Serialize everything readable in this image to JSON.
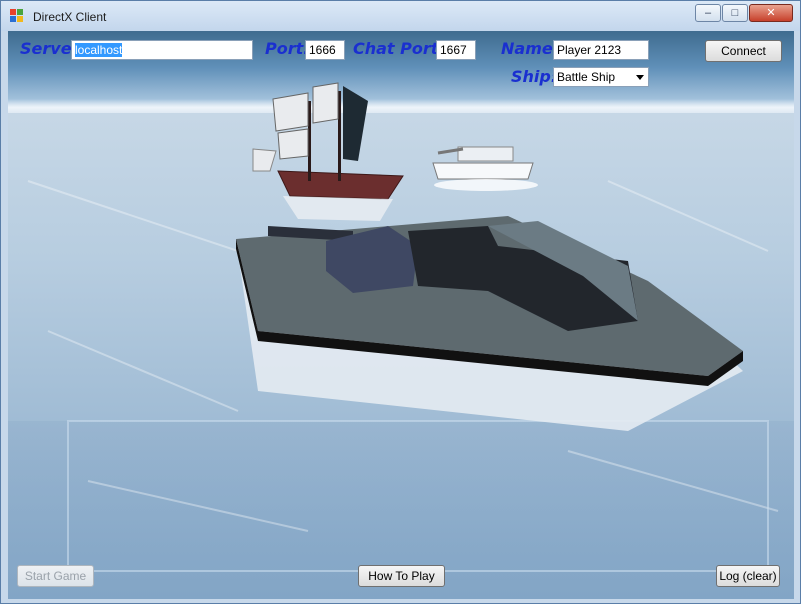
{
  "window": {
    "title": "DirectX Client",
    "minimize_glyph": "–",
    "maximize_glyph": "□",
    "close_glyph": "✕",
    "icon": "app-icon"
  },
  "connection": {
    "server_label": "Server:",
    "server_value": "localhost",
    "port_label": "Port:",
    "port_value": "1666",
    "chat_port_label": "Chat Port:",
    "chat_port_value": "1667",
    "name_label": "Name:",
    "name_value": "Player 2123",
    "ship_label": "Ship:",
    "ship_value": "Battle Ship",
    "connect_label": "Connect"
  },
  "footer": {
    "start_game_label": "Start Game",
    "how_to_play_label": "How To Play",
    "log_label": "Log (clear)"
  },
  "colors": {
    "label_blue": "#1a2fd0",
    "selection": "#3399ff"
  }
}
